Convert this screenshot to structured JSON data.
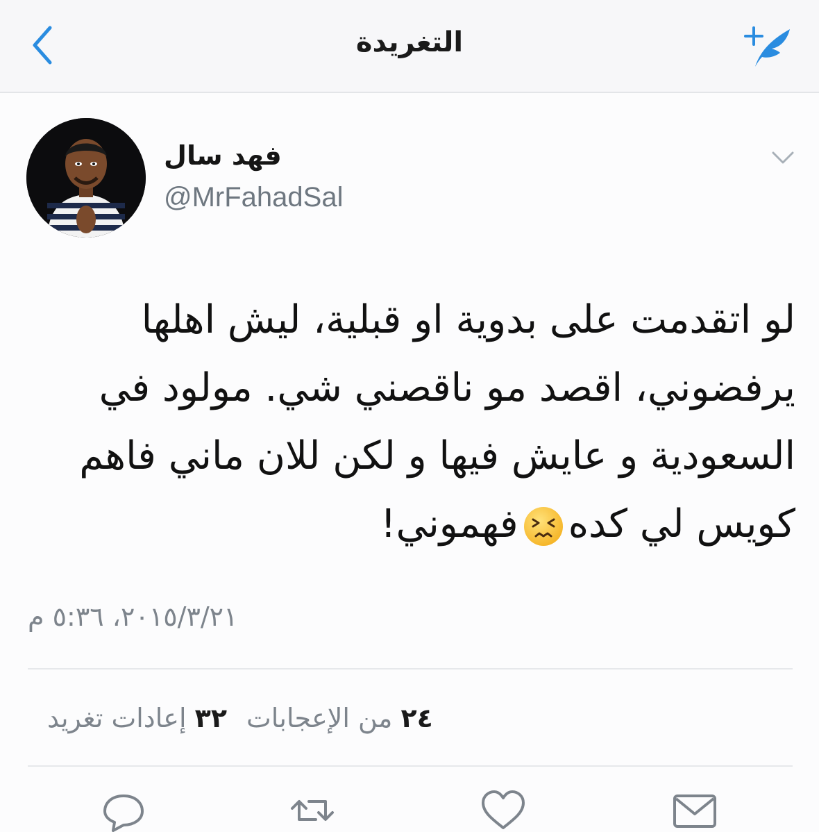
{
  "header": {
    "title": "التغريدة",
    "back_icon": "chevron-left-icon",
    "compose_icon": "compose-tweet-icon",
    "accent_color": "#1d9bf0"
  },
  "author": {
    "name": "فهد سال",
    "handle": "@MrFahadSal",
    "avatar_icon": "avatar-image"
  },
  "tweet": {
    "line1": "لو اتقدمت على بدوية او قبلية، ليش اهلها",
    "line2": "يرفضوني، اقصد مو ناقصني شي. مولود في",
    "line3": "السعودية و عايش فيها و لكن للان ماني فاهم",
    "line4_a": "كويس لي كده",
    "line4_b": "فهموني!",
    "emoji": "persevering-face-emoji",
    "timestamp": "٢٠١٥/٣/٢١، ٥:٣٦ م"
  },
  "stats": {
    "retweets_count": "٣٢",
    "retweets_label": "إعادات تغريد",
    "likes_count": "٢٤",
    "likes_label": "من الإعجابات"
  },
  "actions": [
    "reply-icon",
    "retweet-icon",
    "like-icon",
    "message-icon"
  ]
}
